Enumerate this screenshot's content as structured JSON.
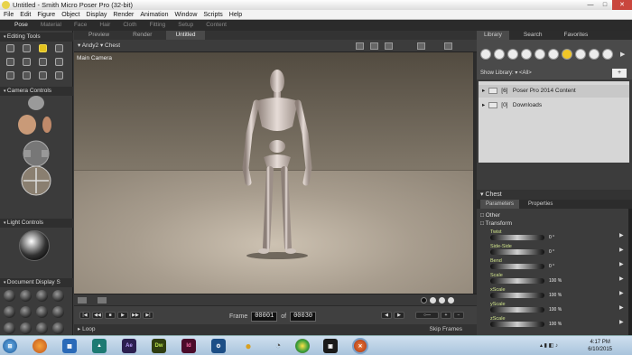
{
  "window": {
    "title": "Untitled - Smith Micro Poser Pro  (32-bit)"
  },
  "menu": [
    "File",
    "Edit",
    "Figure",
    "Object",
    "Display",
    "Render",
    "Animation",
    "Window",
    "Scripts",
    "Help"
  ],
  "rooms": [
    "Pose",
    "Material",
    "Face",
    "Hair",
    "Cloth",
    "Fitting",
    "Setup",
    "Content"
  ],
  "left": {
    "editing_tools": "Editing Tools",
    "camera_controls": "Camera Controls",
    "light_controls": "Light Controls",
    "document_display": "Document Display S"
  },
  "preview_tabs": [
    "Preview",
    "Render",
    "Untitled"
  ],
  "figure_bar": {
    "figure": "Andy2",
    "part": "Chest"
  },
  "viewport": {
    "camera_label": "Main Camera"
  },
  "playback": {
    "frame_label": "Frame",
    "current": "00001",
    "of": "of",
    "total": "00030",
    "loop": "Loop",
    "skip": "Skip Frames"
  },
  "library": {
    "tabs": [
      "Library",
      "Search",
      "Favorites"
    ],
    "show_label": "Show Library:",
    "filter": "<All>",
    "items": [
      {
        "count": "[6]",
        "name": "Poser Pro 2014 Content"
      },
      {
        "count": "[0]",
        "name": "Downloads"
      }
    ]
  },
  "params": {
    "header": "Chest",
    "tabs": [
      "Parameters",
      "Properties"
    ],
    "groups": [
      "Other",
      "Transform"
    ],
    "rows": [
      {
        "label": "Twist",
        "value": "0 °"
      },
      {
        "label": "Side-Side",
        "value": "0 °"
      },
      {
        "label": "Bend",
        "value": "0 °"
      },
      {
        "label": "Scale",
        "value": "100 %"
      },
      {
        "label": "xScale",
        "value": "100 %"
      },
      {
        "label": "yScale",
        "value": "100 %"
      },
      {
        "label": "zScale",
        "value": "100 %"
      }
    ]
  },
  "taskbar": {
    "time": "4:17 PM",
    "date": "6/10/2015"
  }
}
